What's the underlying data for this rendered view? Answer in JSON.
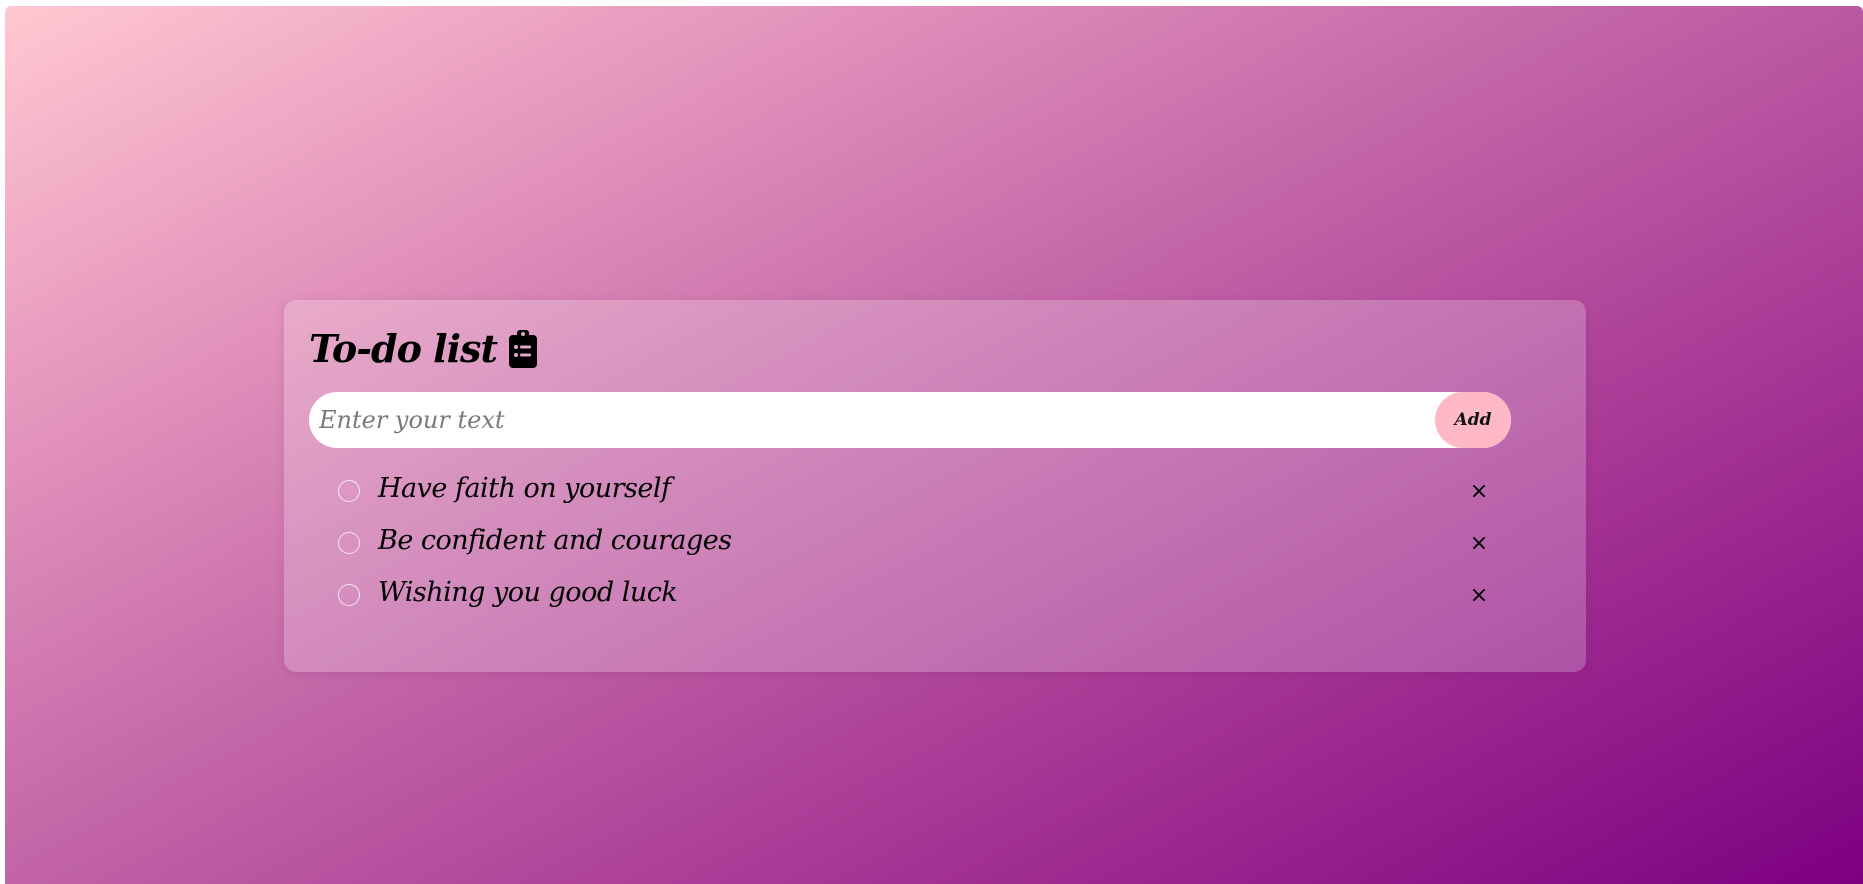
{
  "app": {
    "title": "To-do list",
    "title_icon": "clipboard-list-icon"
  },
  "input": {
    "value": "",
    "placeholder": "Enter your text",
    "add_label": "Add"
  },
  "tasks": [
    {
      "text": "Have faith on yourself",
      "checked": false,
      "remove_label": "×"
    },
    {
      "text": "Be confident and courages",
      "checked": false,
      "remove_label": "×"
    },
    {
      "text": "Wishing you good luck",
      "checked": false,
      "remove_label": "×"
    }
  ],
  "colors": {
    "gradient_start": "#ffc8d1",
    "gradient_end": "#7d0081",
    "add_button": "#ffb9c6",
    "input_bg": "#ffffff"
  }
}
